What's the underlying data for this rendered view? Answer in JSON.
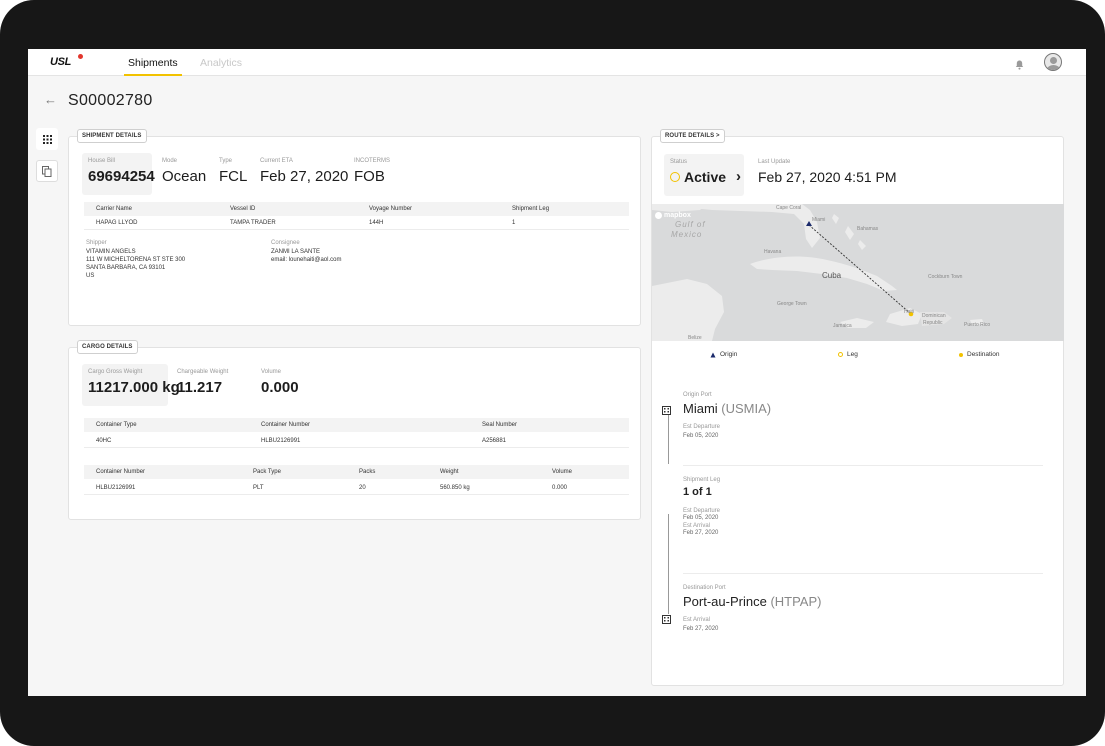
{
  "header": {
    "logo": "USL",
    "tabs": [
      {
        "label": "Shipments",
        "active": true
      },
      {
        "label": "Analytics",
        "active": false
      }
    ]
  },
  "page": {
    "title": "S00002780",
    "back_icon": "arrow-left-icon"
  },
  "shipment_details": {
    "legend": "SHIPMENT DETAILS",
    "summary": [
      {
        "label": "House Bill",
        "value": "69694254"
      },
      {
        "label": "Mode",
        "value": "Ocean"
      },
      {
        "label": "Type",
        "value": "FCL"
      },
      {
        "label": "Current ETA",
        "value": "Feb 27, 2020"
      },
      {
        "label": "INCOTERMS",
        "value": "FOB"
      }
    ],
    "carrier_table": {
      "headers": [
        "Carrier Name",
        "Vessel ID",
        "Voyage Number",
        "Shipment Leg"
      ],
      "rows": [
        [
          "HAPAG LLYOD",
          "TAMPA TRADER",
          "144H",
          "1"
        ]
      ]
    },
    "shipper": {
      "label": "Shipper",
      "lines": [
        "VITAMIN ANGELS",
        "111 W MICHELTORENA ST STE 300",
        "SANTA BARBARA, CA 93101",
        "US"
      ]
    },
    "consignee": {
      "label": "Consignee",
      "lines": [
        "ZANMI LA SANTE",
        "email: lounehaiti@aol.com"
      ]
    }
  },
  "cargo_details": {
    "legend": "CARGO DETAILS",
    "summary": [
      {
        "label": "Cargo Gross Weight",
        "value": "11217.000 kg"
      },
      {
        "label": "Chargeable Weight",
        "value": "11.217"
      },
      {
        "label": "Volume",
        "value": "0.000"
      }
    ],
    "container_table": {
      "headers": [
        "Container Type",
        "Container Number",
        "Seal Number"
      ],
      "rows": [
        [
          "40HC",
          "HLBU2126991",
          "A256881"
        ]
      ]
    },
    "pack_table": {
      "headers": [
        "Container Number",
        "Pack Type",
        "Packs",
        "Weight",
        "Volume"
      ],
      "rows": [
        [
          "HLBU2126991",
          "PLT",
          "20",
          "560.850 kg",
          "0.000"
        ]
      ]
    }
  },
  "route_details": {
    "legend": "ROUTE DETAILS",
    "status_label": "Status",
    "status_value": "Active",
    "last_update_label": "Last Update",
    "last_update_value": "Feb 27, 2020 4:51 PM",
    "map": {
      "attribution": "mapbox",
      "labels": [
        "Gulf of",
        "Mexico",
        "Cuba",
        "Bahamas",
        "Havana",
        "Miami",
        "Jamaica",
        "Haiti",
        "Dominican",
        "Republic",
        "Puerto Rico",
        "George Town",
        "Belize",
        "Cape Coral",
        "Cockburn Town"
      ]
    },
    "legend_items": [
      {
        "label": "Origin",
        "icon": "triangle-icon",
        "color": "#1b2a6b"
      },
      {
        "label": "Leg",
        "icon": "circle-icon",
        "color": "#f2c200"
      },
      {
        "label": "Destination",
        "icon": "dot-icon",
        "color": "#f2c200"
      }
    ],
    "origin": {
      "label": "Origin Port",
      "name": "Miami",
      "code": "(USMIA)",
      "dep_label": "Est Departure",
      "dep_value": "Feb 05, 2020"
    },
    "leg": {
      "label": "Shipment Leg",
      "value": "1 of 1",
      "dep_label": "Est Departure",
      "dep_value": "Feb 05, 2020",
      "arr_label": "Est Arrival",
      "arr_value": "Feb 27, 2020"
    },
    "destination": {
      "label": "Destination Port",
      "name": "Port-au-Prince",
      "code": "(HTPAP)",
      "arr_label": "Est Arrival",
      "arr_value": "Feb 27, 2020"
    }
  },
  "colors": {
    "accent": "#f2c200",
    "brand_red": "#e2362d"
  }
}
